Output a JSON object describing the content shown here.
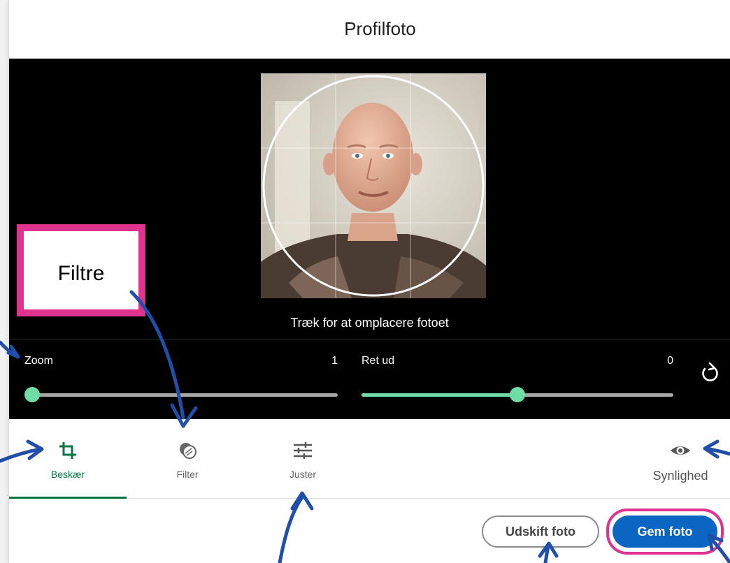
{
  "dialog": {
    "title": "Profilfoto"
  },
  "editor": {
    "hint": "Træk for at omplacere fotoet",
    "zoom": {
      "label": "Zoom",
      "value": "1",
      "fraction": 0.0
    },
    "straighten": {
      "label": "Ret ud",
      "value": "0",
      "fraction": 0.5
    }
  },
  "tools": {
    "crop": "Beskær",
    "filter": "Filter",
    "adjust": "Juster",
    "visibility": "Synlighed"
  },
  "actions": {
    "replace": "Udskift foto",
    "save": "Gem foto"
  },
  "annotation": {
    "callout": "Filtre"
  },
  "colors": {
    "accent_green": "#057642",
    "slider_green": "#6fdca6",
    "primary_blue": "#0a66c2",
    "highlight_pink": "#e0328f",
    "arrow_blue": "#1f4fa8"
  }
}
